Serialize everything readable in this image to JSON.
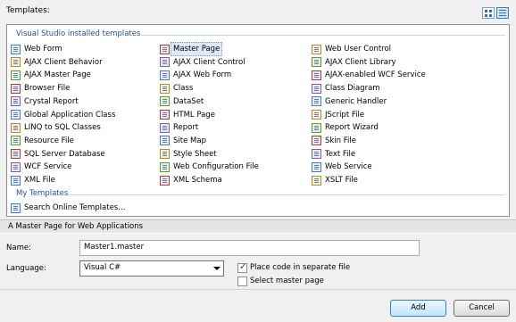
{
  "templates_label": "Templates:",
  "panel": {
    "group_vs": "Visual Studio installed templates",
    "group_my": "My Templates",
    "columns": [
      [
        "Web Form",
        "AJAX Client Behavior",
        "AJAX Master Page",
        "Browser File",
        "Crystal Report",
        "Global Application Class",
        "LINQ to SQL Classes",
        "Resource File",
        "SQL Server Database",
        "WCF Service",
        "XML File"
      ],
      [
        "Master Page",
        "AJAX Client Control",
        "AJAX Web Form",
        "Class",
        "DataSet",
        "HTML Page",
        "Report",
        "Site Map",
        "Style Sheet",
        "Web Configuration File",
        "XML Schema"
      ],
      [
        "Web User Control",
        "AJAX Client Library",
        "AJAX-enabled WCF Service",
        "Class Diagram",
        "Generic Handler",
        "JScript File",
        "Report Wizard",
        "Skin File",
        "Text File",
        "Web Service",
        "XSLT File"
      ]
    ],
    "selected": "Master Page",
    "my_templates": [
      "Search Online Templates..."
    ]
  },
  "description": "A Master Page for Web Applications",
  "name_label": "Name:",
  "name_value": "Master1.master",
  "language_label": "Language:",
  "language_value": "Visual C#",
  "place_code_label": "Place code in separate file",
  "place_code_checked": true,
  "select_master_label": "Select master page",
  "select_master_checked": false,
  "add_label": "Add",
  "cancel_label": "Cancel"
}
